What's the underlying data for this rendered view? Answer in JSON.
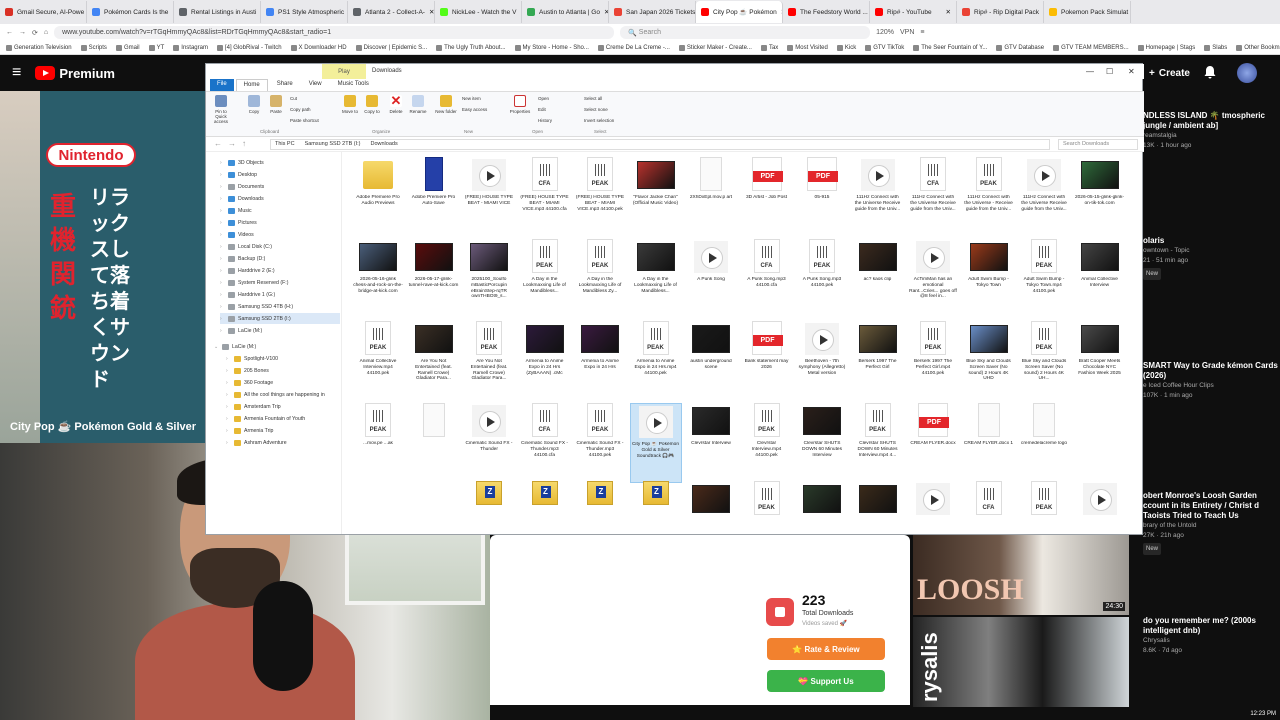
{
  "browser": {
    "tabs": [
      {
        "label": "Gmail Secure, AI-Powe",
        "color": "#d93025"
      },
      {
        "label": "Pokémon Cards Is the",
        "color": "#4285f4"
      },
      {
        "label": "Rental Listings in Austi",
        "color": "#5f6368"
      },
      {
        "label": "PS1 Style Atmospheric",
        "color": "#4285f4"
      },
      {
        "label": "Atlanta 2 - Collect-A-",
        "color": "#5f6368"
      },
      {
        "label": "NickLee - Watch the V",
        "color": "#53fc18"
      },
      {
        "label": "Austin to Atlanta | Go",
        "color": "#34a853"
      },
      {
        "label": "San Japan 2026 Tickets | Si",
        "color": "#ea4335"
      },
      {
        "label": "City Pop ☕ Pokémon",
        "color": "#ff0000"
      },
      {
        "label": "The Feedstory World ...",
        "color": "#ff0000"
      },
      {
        "label": "Rip# - YouTube",
        "color": "#ff0000"
      },
      {
        "label": "Rip# - Rip Digital Pack",
        "color": "#ea4335"
      },
      {
        "label": "Pokemon Pack Simulat",
        "color": "#fbbc04"
      }
    ],
    "active_tab": 8,
    "url": "www.youtube.com/watch?v=rTGqHmmyQAc8&list=RDrTGqHmmyQAc8&start_radio=1",
    "search_placeholder": "Search",
    "zoom": "120%",
    "vpn": "VPN",
    "bookmarks": [
      "Generation Television",
      "Scripts",
      "Gmail",
      "YT",
      "Instagram",
      "[4] GlobRival - Twitch",
      "X Downloader HD",
      "Discover | Epidemic S...",
      "The Ugly Truth About...",
      "My Store - Home - Sho...",
      "Creme De La Creme -...",
      "Sticker Maker - Create...",
      "Tax",
      "Most Visited",
      "Kick",
      "GTV TikTok",
      "The Seer Fountain of Y...",
      "GTV Database",
      "GTV TEAM MEMBERS...",
      "Homepage | Stags",
      "Slabs",
      "Other Bookmarks"
    ]
  },
  "youtube": {
    "logo": "Premium",
    "create": "Create",
    "video_title": "City Pop ☕ Pokémon Gold & Silver",
    "video_overlay": {
      "nintendo": "Nintendo",
      "jp_red": "重機関銃",
      "jp_white": "リラックスして落ち着くサウンド"
    },
    "sidebar": [
      {
        "title": "NDLESS ISLAND 🌴 tmospheric jungle / ambient ab]",
        "channel": "reamstalgia",
        "meta": "13K · 1 hour ago"
      },
      {
        "title": "olaris",
        "channel": "owntown - Topic",
        "meta": "21 · 51 min ago",
        "badge": "New"
      },
      {
        "title": "SMART Way to Grade kémon Cards (2026)",
        "channel": "e Iced Coffee Hour Clips",
        "meta": "107K · 1 min ago"
      },
      {
        "title": "obert Monroe's Loosh Garden ccount in its Entirety / Christ d Taoists Tried to Teach Us",
        "channel": "brary of the Untold",
        "meta": "27K · 21h ago",
        "badge": "New"
      },
      {
        "title": "do you remember me? (2000s intelligent dnb)",
        "channel": "Chrysalis",
        "meta": "8.6K · 7d ago"
      }
    ],
    "thumb1_text": "LOOSH",
    "thumb1_duration": "24:30",
    "thumb2_text": "rysalis"
  },
  "download_widget": {
    "count": "223",
    "label": "Total Downloads",
    "sublabel": "Videos saved 🚀",
    "rate_button": "⭐ Rate & Review",
    "support_button": "💝 Support Us"
  },
  "explorer": {
    "title": "Downloads",
    "play_tab": "Play",
    "ribbon_tabs": [
      "File",
      "Home",
      "Share",
      "View",
      "Music Tools"
    ],
    "ribbon": {
      "pin": "Pin to Quick access",
      "copy": "Copy",
      "paste": "Paste",
      "cut": "Cut",
      "copy_path": "Copy path",
      "paste_shortcut": "Paste shortcut",
      "move_to": "Move to",
      "copy_to": "Copy to",
      "delete": "Delete",
      "rename": "Rename",
      "new_folder": "New folder",
      "new_item": "New item",
      "easy_access": "Easy access",
      "properties": "Properties",
      "open": "Open",
      "edit": "Edit",
      "history": "History",
      "select_all": "Select all",
      "select_none": "Select none",
      "invert_selection": "Invert selection",
      "groups": [
        "Clipboard",
        "Organize",
        "New",
        "Open",
        "Select"
      ]
    },
    "breadcrumb": [
      "This PC",
      "Samsung SSD 2TB (I:)",
      "Downloads"
    ],
    "search_placeholder": "Search Downloads",
    "nav": [
      {
        "label": "3D Objects",
        "color": "#3d8fd8"
      },
      {
        "label": "Desktop",
        "color": "#3d8fd8"
      },
      {
        "label": "Documents",
        "color": "#9aa0a6"
      },
      {
        "label": "Downloads",
        "color": "#3d8fd8"
      },
      {
        "label": "Music",
        "color": "#3d8fd8"
      },
      {
        "label": "Pictures",
        "color": "#3d8fd8"
      },
      {
        "label": "Videos",
        "color": "#3d8fd8"
      },
      {
        "label": "Local Disk (C:)",
        "color": "#9aa0a6"
      },
      {
        "label": "Backup (D:)",
        "color": "#9aa0a6"
      },
      {
        "label": "Harddrive 2 (E:)",
        "color": "#9aa0a6"
      },
      {
        "label": "System Reserved (F:)",
        "color": "#9aa0a6"
      },
      {
        "label": "Harddrive 1 (G:)",
        "color": "#9aa0a6"
      },
      {
        "label": "Samsung SSD 4TB (H:)",
        "color": "#9aa0a6"
      },
      {
        "label": "Samsung SSD 2TB (I:)",
        "color": "#9aa0a6"
      },
      {
        "label": "LaCie (M:)",
        "color": "#9aa0a6"
      },
      {
        "label": "LaCie (M:)",
        "color": "#9aa0a6"
      },
      {
        "label": "Spotlight-V100",
        "color": "#e7b933"
      },
      {
        "label": "205 Bones",
        "color": "#e7b933"
      },
      {
        "label": "360 Footage",
        "color": "#e7b933"
      },
      {
        "label": "All the cool things are happening in",
        "color": "#e7b933"
      },
      {
        "label": "Amsterdam Trip",
        "color": "#e7b933"
      },
      {
        "label": "Armenia Fountain of Youth",
        "color": "#e7b933"
      },
      {
        "label": "Armenia Trip",
        "color": "#e7b933"
      },
      {
        "label": "Ashram Adventure",
        "color": "#e7b933"
      }
    ],
    "files": [
      {
        "type": "folder",
        "label": "Adobe Premiere Pro Audio Previews"
      },
      {
        "type": "blue",
        "label": "Adobe Premiere Pro Auto-Save"
      },
      {
        "type": "play",
        "label": "(FREE) HOUSE TYPE BEAT - MIAMI VICE"
      },
      {
        "type": "doc",
        "mark": "CFA",
        "label": "(FREE) HOUSE TYPE BEAT - MIAMI VICE.mp3 44100.cfa"
      },
      {
        "type": "doc",
        "mark": "PEAK",
        "label": "(FREE) HOUSE TYPE BEAT - MIAMI VICE.mp3 44100.pek"
      },
      {
        "type": "img",
        "color": "#b8322d",
        "label": "\"Flavor Jackie Chan\" (Official Music Video)"
      },
      {
        "type": "blank",
        "label": "2XhDxEpl.mov.p art"
      },
      {
        "type": "pdf",
        "label": "3D Artist - Job Post"
      },
      {
        "type": "pdf",
        "label": "05-915"
      },
      {
        "type": "play",
        "label": "111Hz Connect with the Universe Receive guide from the Univ..."
      },
      {
        "type": "doc",
        "mark": "CFA",
        "label": "111Hz Connect with the Universe Receive guide from the Univ..."
      },
      {
        "type": "doc",
        "mark": "PEAK",
        "label": "111Hz Connect with the Universe - Receive guide from the Univ..."
      },
      {
        "type": "play",
        "label": "111Hz Connect with the Universe Receive guide from the Univ..."
      },
      {
        "type": "img",
        "color": "#2f6a3a",
        "label": "2026-05-15-glink-glink-on-tik-tok.com"
      },
      {
        "type": "img",
        "color": "#4a5e7a",
        "label": "2026-05-16-glink chess-and-rock-on-the-bridge-at-kick.com"
      },
      {
        "type": "img",
        "color": "#5a0c0c",
        "label": "2026-05-17-glink-tunnel-rave-at-kick.com"
      },
      {
        "type": "img",
        "color": "#6b5a7a",
        "label": "2025100_Soulfo mBasticPorcupin eBrainStep-rqTR ownTHBOt9_s..."
      },
      {
        "type": "doc",
        "mark": "PEAK",
        "label": "A Day in the Lookmaxxing Life of Mandibless..."
      },
      {
        "type": "doc",
        "mark": "PEAK",
        "label": "A Day in the Lookmaxxing Life of Mandibless Zy..."
      },
      {
        "type": "img",
        "color": "#3a3a3a",
        "label": "A Day in the Lookmaxxing Life of Mandibless..."
      },
      {
        "type": "play",
        "label": "A Punk Song"
      },
      {
        "type": "doc",
        "mark": "CFA",
        "label": "A Punk Song.mp3 44100.cfa"
      },
      {
        "type": "doc",
        "mark": "PEAK",
        "label": "A Punk Song.mp3 44100.pek"
      },
      {
        "type": "img",
        "color": "#3b2a1e",
        "label": "ac? kaos clip"
      },
      {
        "type": "play",
        "label": "AcTimMan has an emotional Rant...Cries... goes off @8 feel in..."
      },
      {
        "type": "img",
        "color": "#9a3a1a",
        "label": "Adult Swim Bump - Tokyo Town"
      },
      {
        "type": "doc",
        "mark": "PEAK",
        "label": "Adult Swim Bump - Tokyo Town.mp4 44100.pek"
      },
      {
        "type": "img",
        "color": "#444",
        "label": "Animal Collective Interview"
      },
      {
        "type": "doc",
        "mark": "PEAK",
        "label": "Animal Collective Interview.mp4 44100.pek"
      },
      {
        "type": "img",
        "color": "#3a2f25",
        "label": "Are You Not Entertained (feat. Ramell Crowe) Gladiator Para..."
      },
      {
        "type": "doc",
        "mark": "PEAK",
        "label": "Are You Not Entertained (feat. Ramell Crowe) Gladiator Para..."
      },
      {
        "type": "img",
        "color": "#2c1a3a",
        "label": "Armenia to Anime Expo in 24 Hrs (ZyBAAAN) .cMc"
      },
      {
        "type": "img",
        "color": "#3a1a40",
        "label": "Armenia to Anime Expo in 24 Hrs"
      },
      {
        "type": "doc",
        "mark": "PEAK",
        "label": "Armenia to Anime Expo in 24 Hrs.mp4 44100.pek"
      },
      {
        "type": "img",
        "color": "#1a1a1a",
        "label": "austin underground scene"
      },
      {
        "type": "pdf",
        "label": "Bank statement may 2026"
      },
      {
        "type": "play",
        "label": "Beethoven - 7th symphony (Allegretto) Metal version"
      },
      {
        "type": "img",
        "color": "#6a5a3a",
        "label": "Berserk 1997 The Perfect Girl"
      },
      {
        "type": "doc",
        "mark": "PEAK",
        "label": "Berserk 1997 The Perfect Girl.mp4 44100.pek"
      },
      {
        "type": "img",
        "color": "#6a8fc8",
        "label": "Blue Sky and Clouds Screen Saver (No sound) 2 Hours 4K UHD"
      },
      {
        "type": "doc",
        "mark": "PEAK",
        "label": "Blue Sky and Clouds Screen Saver (No sound) 2 Hours 4K UH..."
      },
      {
        "type": "img",
        "color": "#4a4a4a",
        "label": "Bratt Cooper Meets Chocolate NYC Fashion Week 2025"
      },
      {
        "type": "doc",
        "mark": "PEAK",
        "label": "...mov.pe ...ak"
      },
      {
        "type": "blank",
        "label": ""
      },
      {
        "type": "play",
        "label": "Cinematic Sound FX - Thunder"
      },
      {
        "type": "doc",
        "mark": "CFA",
        "label": "Cinematic Sound FX - Thunder.mp3 44100.cfa"
      },
      {
        "type": "doc",
        "mark": "PEAK",
        "label": "Cinematic Sound FX - Thunder.mp3 44100.pek"
      },
      {
        "type": "play",
        "label": "City Pop ☕ Pokémon Gold & Silver Soundtrack 🎧🎮",
        "selected": true
      },
      {
        "type": "img",
        "color": "#2a2a2a",
        "label": "Clevrstar Interview"
      },
      {
        "type": "doc",
        "mark": "PEAK",
        "label": "Clevrstar Interview.mp4 44100.pek"
      },
      {
        "type": "img",
        "color": "#2a1f1a",
        "label": "Clevrstar SHUTS DOWN 60 Minutes Interview"
      },
      {
        "type": "doc",
        "mark": "PEAK",
        "label": "Clevrstar SHUTS DOWN 60 Minutes Interview.mp4 4..."
      },
      {
        "type": "pdf",
        "label": "CREAM FLYER.docx"
      },
      {
        "type": "blank",
        "label": "CREAM FLYER.docx 1"
      },
      {
        "type": "blank",
        "label": "cremedelacreme logo"
      }
    ],
    "bottom_row": [
      {
        "type": "zip"
      },
      {
        "type": "zip"
      },
      {
        "type": "zip"
      },
      {
        "type": "zip"
      },
      {
        "type": "img",
        "color": "#4a2a1a"
      },
      {
        "type": "doc",
        "mark": "PEAK"
      },
      {
        "type": "img",
        "color": "#2a3a2a"
      },
      {
        "type": "img",
        "color": "#3a2a1a"
      },
      {
        "type": "play"
      },
      {
        "type": "doc",
        "mark": "CFA"
      },
      {
        "type": "doc",
        "mark": "PEAK"
      },
      {
        "type": "play"
      }
    ]
  },
  "clock": "12:23 PM"
}
